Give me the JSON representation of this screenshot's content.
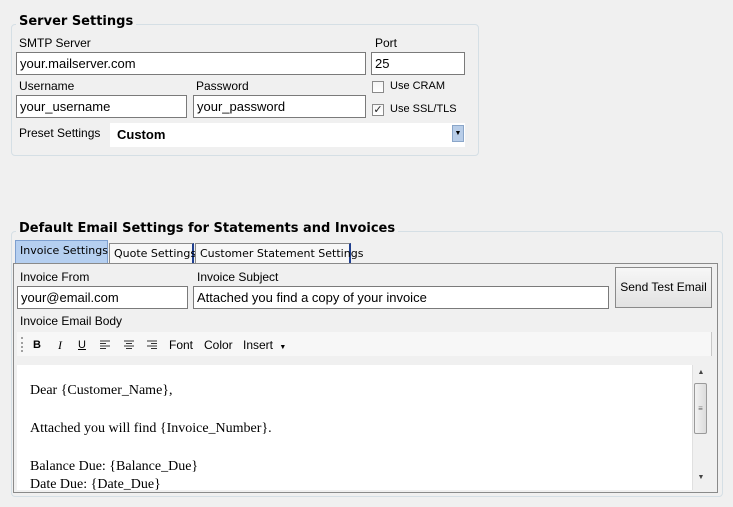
{
  "server": {
    "title": "Server Settings",
    "smtp_label": "SMTP Server",
    "smtp_value": "your.mailserver.com",
    "port_label": "Port",
    "port_value": "25",
    "username_label": "Username",
    "username_value": "your_username",
    "password_label": "Password",
    "password_value": "your_password",
    "use_cram_label": "Use CRAM",
    "use_cram_checked": false,
    "use_ssl_label": "Use SSL/TLS",
    "use_ssl_checked": true,
    "preset_label": "Preset Settings",
    "preset_value": "Custom"
  },
  "email": {
    "title": "Default Email Settings for Statements and Invoices",
    "tabs": [
      {
        "label": "Invoice Settings",
        "active": true
      },
      {
        "label": "Quote Settings",
        "active": false
      },
      {
        "label": "Customer Statement Settings",
        "active": false
      }
    ],
    "from_label": "Invoice From",
    "from_value": "your@email.com",
    "subject_label": "Invoice Subject",
    "subject_value": "Attached you find a copy of your invoice",
    "send_test_label": "Send Test Email",
    "body_label": "Invoice Email Body",
    "toolbar": {
      "bold": "B",
      "italic": "I",
      "underline": "U",
      "font": "Font",
      "color": "Color",
      "insert": "Insert"
    },
    "body_lines": [
      "Dear {Customer_Name},",
      "Attached you will find {Invoice_Number}.",
      "Balance Due: {Balance_Due}",
      "Date Due: {Date_Due}"
    ]
  }
}
